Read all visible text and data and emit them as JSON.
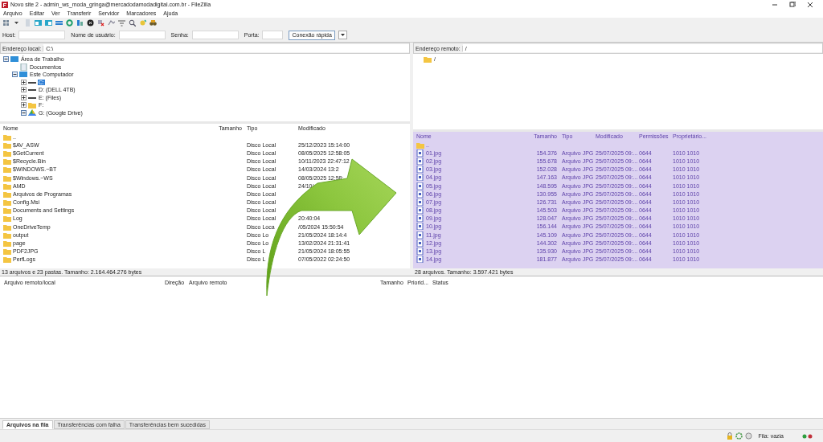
{
  "window": {
    "title": "Novo site 2 - admin_ws_moda_gringa@mercadodamodadigital.com.br - FileZilla"
  },
  "menu": [
    "Arquivo",
    "Editar",
    "Ver",
    "Transferir",
    "Servidor",
    "Marcadores",
    "Ajuda"
  ],
  "quickconnect": {
    "fields": [
      {
        "label": "Host:"
      },
      {
        "label": "Nome de usuário:"
      },
      {
        "label": "Senha:"
      },
      {
        "label": "Porta:"
      }
    ],
    "button": "Conexão rápida"
  },
  "local": {
    "address_label": "Endereço local:",
    "address": "C:\\",
    "tree": [
      {
        "label": "Área de Trabalho",
        "kind": "desktop",
        "expanded": true,
        "children": [
          {
            "label": "Documentos",
            "kind": "doc"
          },
          {
            "label": "Este Computador",
            "kind": "desktop",
            "expanded": true,
            "children": [
              {
                "label": "C:",
                "kind": "drive",
                "selected": true,
                "expanded": false
              },
              {
                "label": "D: (DELL 4TB)",
                "kind": "drive",
                "selected": false,
                "expanded": false
              },
              {
                "label": "E: (Files)",
                "kind": "drive",
                "selected": false,
                "expanded": false
              },
              {
                "label": "F:",
                "kind": "folder",
                "selected": false,
                "expanded": false
              },
              {
                "label": "G: (Google Drive)",
                "kind": "cloud",
                "selected": false,
                "expanded": true
              }
            ]
          }
        ]
      }
    ],
    "columns": [
      "Nome",
      "Tamanho",
      "Tipo",
      "Modificado"
    ],
    "rows": [
      {
        "name": ".."
      },
      {
        "name": "$AV_ASW",
        "type": "Disco Local",
        "modified": "25/12/2023 15:14:00"
      },
      {
        "name": "$GetCurrent",
        "type": "Disco Local",
        "modified": "08/05/2025 12:58:05"
      },
      {
        "name": "$Recycle.Bin",
        "type": "Disco Local",
        "modified": "10/11/2023 22:47:12"
      },
      {
        "name": "$WINDOWS.~BT",
        "type": "Disco Local",
        "modified": "14/03/2024 13:2"
      },
      {
        "name": "$Windows.~WS",
        "type": "Disco Local",
        "modified": "08/05/2025 12:58:"
      },
      {
        "name": "AMD",
        "type": "Disco Local",
        "modified": "24/10/"
      },
      {
        "name": "Arquivos de Programas",
        "type": "Disco Local"
      },
      {
        "name": "Config.Msi",
        "type": "Disco Local"
      },
      {
        "name": "Documents and Settings",
        "type": "Disco Local"
      },
      {
        "name": "Log",
        "type": "Disco Local",
        "modified": "20:40:04"
      },
      {
        "name": "OneDriveTemp",
        "type": "Disco Loca",
        "modified": "/05/2024 15:50:54"
      },
      {
        "name": "output",
        "type": "Disco Lo",
        "modified": "21/05/2024 18:14:4"
      },
      {
        "name": "page",
        "type": "Disco Lo",
        "modified": "13/02/2024 21:31:41"
      },
      {
        "name": "PDF2JPG",
        "type": "Disco L",
        "modified": "21/05/2024 18:05:55"
      },
      {
        "name": "PerfLogs",
        "type": "Disco L",
        "modified": "07/05/2022 02:24:50"
      }
    ],
    "status": "13 arquivos e 23 pastas. Tamanho: 2.164.464.276 bytes"
  },
  "remote": {
    "address_label": "Endereço remoto:",
    "address": "/",
    "tree": [
      {
        "label": "/",
        "kind": "folder"
      }
    ],
    "highlighted": true,
    "columns": [
      "Nome",
      "Tamanho",
      "Tipo",
      "Modificado",
      "Permissões",
      "Proprietário..."
    ],
    "rows": [
      {
        "name": ".."
      },
      {
        "name": "01.jpg",
        "size": "154.376",
        "type": "Arquivo JPG",
        "modified": "25/07/2025 09:...",
        "perms": "0644",
        "owner": "1010 1010"
      },
      {
        "name": "02.jpg",
        "size": "155.678",
        "type": "Arquivo JPG",
        "modified": "25/07/2025 09:...",
        "perms": "0644",
        "owner": "1010 1010"
      },
      {
        "name": "03.jpg",
        "size": "152.028",
        "type": "Arquivo JPG",
        "modified": "25/07/2025 09:...",
        "perms": "0644",
        "owner": "1010 1010"
      },
      {
        "name": "04.jpg",
        "size": "147.163",
        "type": "Arquivo JPG",
        "modified": "25/07/2025 09:...",
        "perms": "0644",
        "owner": "1010 1010"
      },
      {
        "name": "05.jpg",
        "size": "148.595",
        "type": "Arquivo JPG",
        "modified": "25/07/2025 09:...",
        "perms": "0644",
        "owner": "1010 1010"
      },
      {
        "name": "06.jpg",
        "size": "130.955",
        "type": "Arquivo JPG",
        "modified": "25/07/2025 09:...",
        "perms": "0644",
        "owner": "1010 1010"
      },
      {
        "name": "07.jpg",
        "size": "126.731",
        "type": "Arquivo JPG",
        "modified": "25/07/2025 09:...",
        "perms": "0644",
        "owner": "1010 1010"
      },
      {
        "name": "08.jpg",
        "size": "145.503",
        "type": "Arquivo JPG",
        "modified": "25/07/2025 09:...",
        "perms": "0644",
        "owner": "1010 1010"
      },
      {
        "name": "09.jpg",
        "size": "128.047",
        "type": "Arquivo JPG",
        "modified": "25/07/2025 09:...",
        "perms": "0644",
        "owner": "1010 1010"
      },
      {
        "name": "10.jpg",
        "size": "156.144",
        "type": "Arquivo JPG",
        "modified": "25/07/2025 09:...",
        "perms": "0644",
        "owner": "1010 1010"
      },
      {
        "name": "11.jpg",
        "size": "145.109",
        "type": "Arquivo JPG",
        "modified": "25/07/2025 09:...",
        "perms": "0644",
        "owner": "1010 1010"
      },
      {
        "name": "12.jpg",
        "size": "144.302",
        "type": "Arquivo JPG",
        "modified": "25/07/2025 09:...",
        "perms": "0644",
        "owner": "1010 1010"
      },
      {
        "name": "13.jpg",
        "size": "135.930",
        "type": "Arquivo JPG",
        "modified": "25/07/2025 09:...",
        "perms": "0644",
        "owner": "1010 1010"
      },
      {
        "name": "14.jpg",
        "size": "181.877",
        "type": "Arquivo JPG",
        "modified": "25/07/2025 09:...",
        "perms": "0644",
        "owner": "1010 1010"
      }
    ],
    "status": "28 arquivos. Tamanho: 3.597.421 bytes"
  },
  "queue": {
    "columns": [
      "Arquivo remoto/local",
      "Direção",
      "Arquivo remoto",
      "Tamanho",
      "Priorid...",
      "Status"
    ]
  },
  "tabs": [
    {
      "label": "Arquivos na fila",
      "selected": true
    },
    {
      "label": "Transferências com falha",
      "selected": false
    },
    {
      "label": "Transferências bem sucedidas",
      "selected": false
    }
  ],
  "status_bar": {
    "queue": "Fila: vazia"
  }
}
